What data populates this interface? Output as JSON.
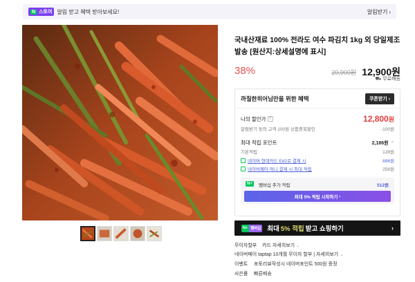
{
  "notice": {
    "store_label": "스토어",
    "store_n": "N",
    "message": "알림 받고 혜택 받아보세요!",
    "alarm_button": "알림받기"
  },
  "product": {
    "title": "국내산재료 100% 전라도 여수 파김치 1kg 외 당일제조 발송 [원산지:상세설명에 표시]",
    "discount": "38%",
    "original_price": "20,900원",
    "sale_price": "12,900원",
    "shipping": "무료배송"
  },
  "benefits": {
    "title": "까칠한히어님만을 위한 혜택",
    "coupon_button": "쿠폰받기",
    "my_price_label": "나의 할인가",
    "my_price_value": "12,800",
    "my_price_unit": "원",
    "alarm_coupon_label": "알림받기 동의 고객 100원 상품중복할인",
    "alarm_coupon_amount": "-100원",
    "max_points_label": "최대 적립 포인트",
    "max_points_value": "2,186원",
    "basic_points_label": "기본적립",
    "basic_points_value": "128원",
    "hyundai_card_label": "네이버 현대카드 Ed2로 결제 시",
    "hyundai_card_value": "896원",
    "money_pay_label": "네이버페이 머니 결제 시 최대 적립",
    "money_pay_value": "256원",
    "membership_badge": "N+",
    "membership_label": "멤버십 추가 적립",
    "membership_value": "512원",
    "membership_cta": "최대 5% 적립 시작하기"
  },
  "promo": {
    "badge_n": "N+",
    "badge_text": "멤버십",
    "text_before": "최대",
    "highlight": "5% 적립",
    "text_after": "받고 쇼핑하기"
  },
  "extras": [
    {
      "key": "무이자할부",
      "value": "카드 자세히보기"
    },
    {
      "key": "",
      "value": "네이버페이 taptap 10개월 무이자 할부 | 자세히보기"
    },
    {
      "key": "이벤트",
      "value": "포토리뷰작성시 네이버포인트 500원 증정"
    },
    {
      "key": "사은품",
      "value": "빠른배송"
    }
  ],
  "colors": {
    "accent_red": "#e25252",
    "store_purple": "#7b3ff2",
    "naver_green": "#03c75a",
    "link_blue": "#4a5fd8"
  },
  "icons": [
    "chevron-right-icon",
    "question-icon",
    "check-icon",
    "truck-icon"
  ]
}
